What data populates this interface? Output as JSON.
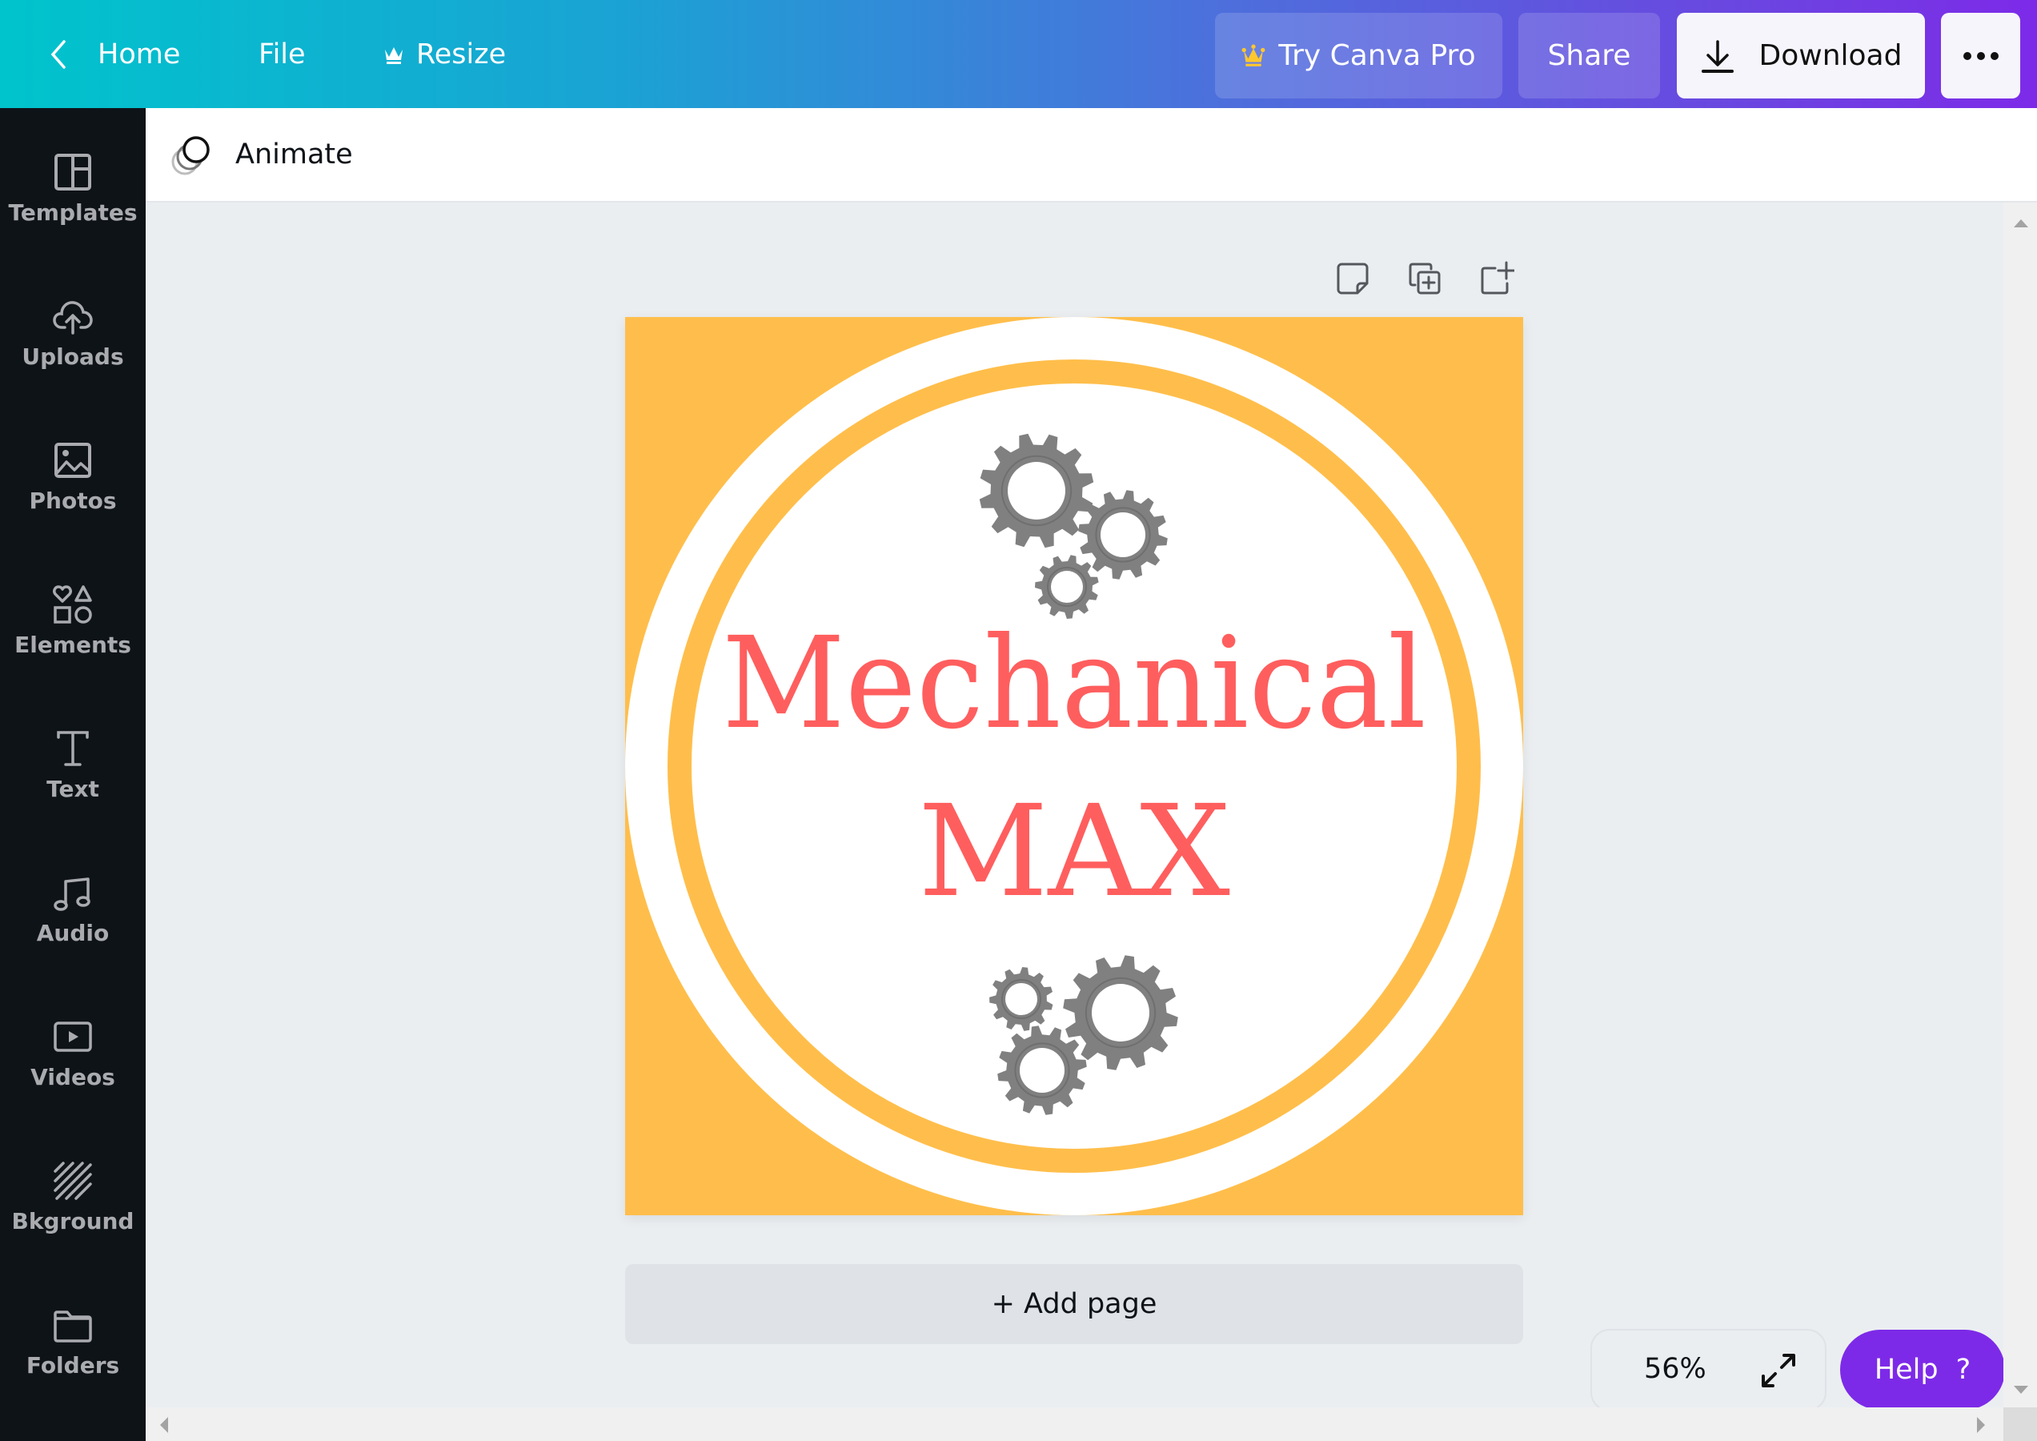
{
  "header": {
    "back_icon": "chevron-left-icon",
    "home": "Home",
    "file": "File",
    "resize": "Resize",
    "try_pro": "Try Canva Pro",
    "share": "Share",
    "download": "Download",
    "more": "•••",
    "colors": {
      "crown": "#ffc72c",
      "help": "#7d2ae8"
    }
  },
  "sidebar": {
    "items": [
      {
        "label": "Templates",
        "icon": "templates-icon"
      },
      {
        "label": "Uploads",
        "icon": "cloud-upload-icon"
      },
      {
        "label": "Photos",
        "icon": "image-icon"
      },
      {
        "label": "Elements",
        "icon": "shapes-icon"
      },
      {
        "label": "Text",
        "icon": "text-icon"
      },
      {
        "label": "Audio",
        "icon": "music-note-icon"
      },
      {
        "label": "Videos",
        "icon": "video-icon"
      },
      {
        "label": "Bkground",
        "icon": "background-stripes-icon"
      },
      {
        "label": "Folders",
        "icon": "folder-icon"
      }
    ]
  },
  "toolbar": {
    "animate": "Animate"
  },
  "page_tools": [
    "notes-icon",
    "duplicate-page-icon",
    "add-page-icon"
  ],
  "design": {
    "title_line1": "Mechanical",
    "title_line2": "MAX",
    "colors": {
      "background": "#ffbe4b",
      "ring": "#ffbe4b",
      "circle": "#ffffff",
      "text": "#ff5e5e",
      "gear": "#808080"
    }
  },
  "add_page": "+ Add page",
  "zoom": {
    "value": "56%"
  },
  "help": {
    "label": "Help",
    "icon": "?"
  }
}
